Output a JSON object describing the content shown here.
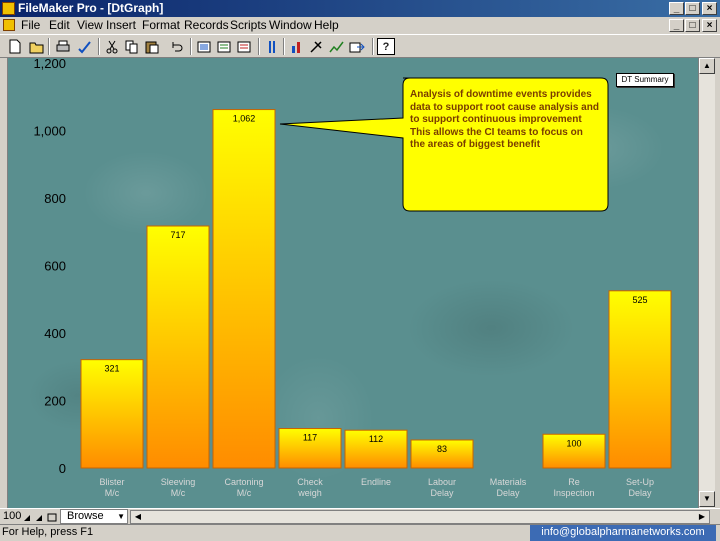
{
  "window": {
    "title": "FileMaker Pro - [DtGraph]",
    "controls_top": [
      "_",
      "□",
      "×"
    ],
    "controls_doc": [
      "_",
      "□",
      "×"
    ]
  },
  "menu": [
    "File",
    "Edit",
    "View",
    "Insert",
    "Format",
    "Records",
    "Scripts",
    "Window",
    "Help"
  ],
  "toolbar": {
    "icons": [
      "new-icon",
      "open-icon",
      "print-icon",
      "spelling-icon",
      "cut-icon",
      "copy-icon",
      "paste-icon",
      "undo-icon",
      "sort-icon",
      "find-icon",
      "omit-icon",
      "script-icon",
      "graph-icon",
      "tools-icon",
      "chart-icon",
      "export-icon",
      "help-icon"
    ]
  },
  "callout": {
    "text": "Analysis of downtime events provides data to support root cause analysis and to support continuous improvement This allows the CI teams to focus on the areas of biggest benefit"
  },
  "summary_button": "DT Summary",
  "chart_data": {
    "type": "bar",
    "categories": [
      [
        "Blister",
        "M/c"
      ],
      [
        "Sleeving",
        "M/c"
      ],
      [
        "Cartoning",
        "M/c"
      ],
      [
        "Check",
        "weigh"
      ],
      [
        "Endline",
        ""
      ],
      [
        "Labour",
        "Delay"
      ],
      [
        "Materials",
        "Delay"
      ],
      [
        "Re",
        "Inspection"
      ],
      [
        "Set-Up",
        "Delay"
      ]
    ],
    "values": [
      321,
      717,
      1062,
      117,
      112,
      83,
      0,
      100,
      525
    ],
    "value_labels": [
      "321",
      "717",
      "1,062",
      "117",
      "112",
      "83",
      "",
      "100",
      "525"
    ],
    "ylim": [
      0,
      1200
    ],
    "yticks": [
      0,
      200,
      400,
      600,
      800,
      1000,
      1200
    ],
    "ytick_labels": [
      "0",
      "200",
      "400",
      "600",
      "800",
      "1,000",
      "1,200"
    ],
    "grid": false,
    "bar_color_top": "#ffff00",
    "bar_color_bottom": "#ff8c00"
  },
  "status": {
    "zoom": "100",
    "mode": "Browse",
    "help": "For Help, press F1",
    "email": "info@globalpharmanetworks.com"
  }
}
